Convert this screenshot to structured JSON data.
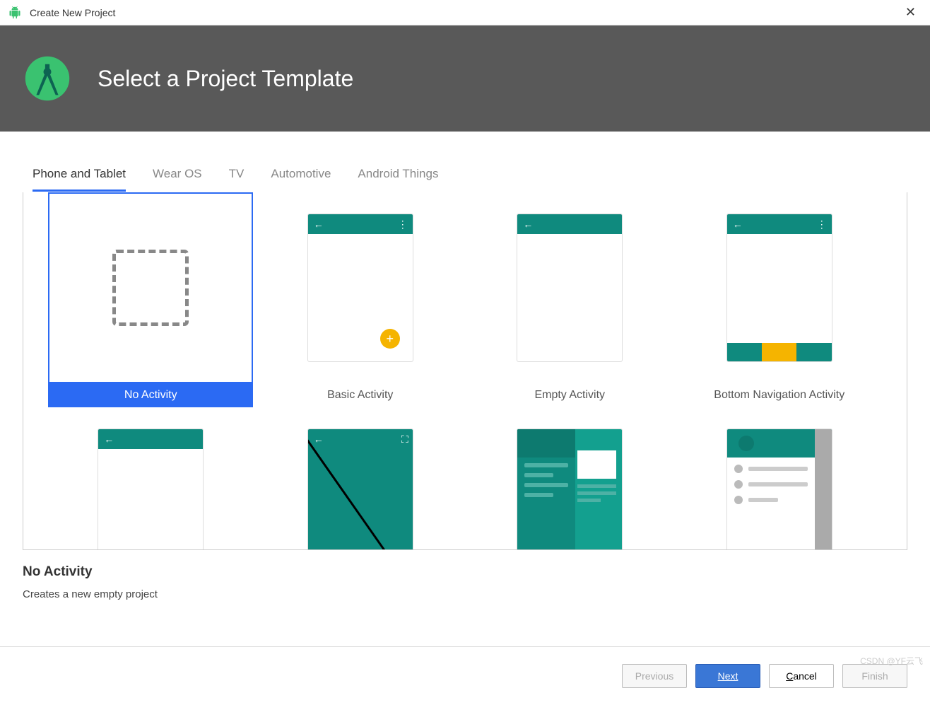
{
  "window": {
    "title": "Create New Project"
  },
  "banner": {
    "title": "Select a Project Template"
  },
  "tabs": [
    {
      "label": "Phone and Tablet",
      "active": true
    },
    {
      "label": "Wear OS",
      "active": false
    },
    {
      "label": "TV",
      "active": false
    },
    {
      "label": "Automotive",
      "active": false
    },
    {
      "label": "Android Things",
      "active": false
    }
  ],
  "templates": [
    {
      "label": "No Activity",
      "selected": true,
      "kind": "none"
    },
    {
      "label": "Basic Activity",
      "selected": false,
      "kind": "basic"
    },
    {
      "label": "Empty Activity",
      "selected": false,
      "kind": "empty"
    },
    {
      "label": "Bottom Navigation Activity",
      "selected": false,
      "kind": "bottomnav"
    },
    {
      "label": "",
      "selected": false,
      "kind": "empty"
    },
    {
      "label": "",
      "selected": false,
      "kind": "fullscreen"
    },
    {
      "label": "",
      "selected": false,
      "kind": "drawer"
    },
    {
      "label": "",
      "selected": false,
      "kind": "listdetail"
    }
  ],
  "selection": {
    "title": "No Activity",
    "description": "Creates a new empty project"
  },
  "buttons": {
    "previous": "Previous",
    "next": "Next",
    "cancel": "Cancel",
    "finish": "Finish"
  },
  "watermark": "CSDN @YF云飞",
  "colors": {
    "accent": "#2b6af3",
    "teal": "#0f8a7e",
    "amber": "#f5b400",
    "banner": "#595959"
  }
}
